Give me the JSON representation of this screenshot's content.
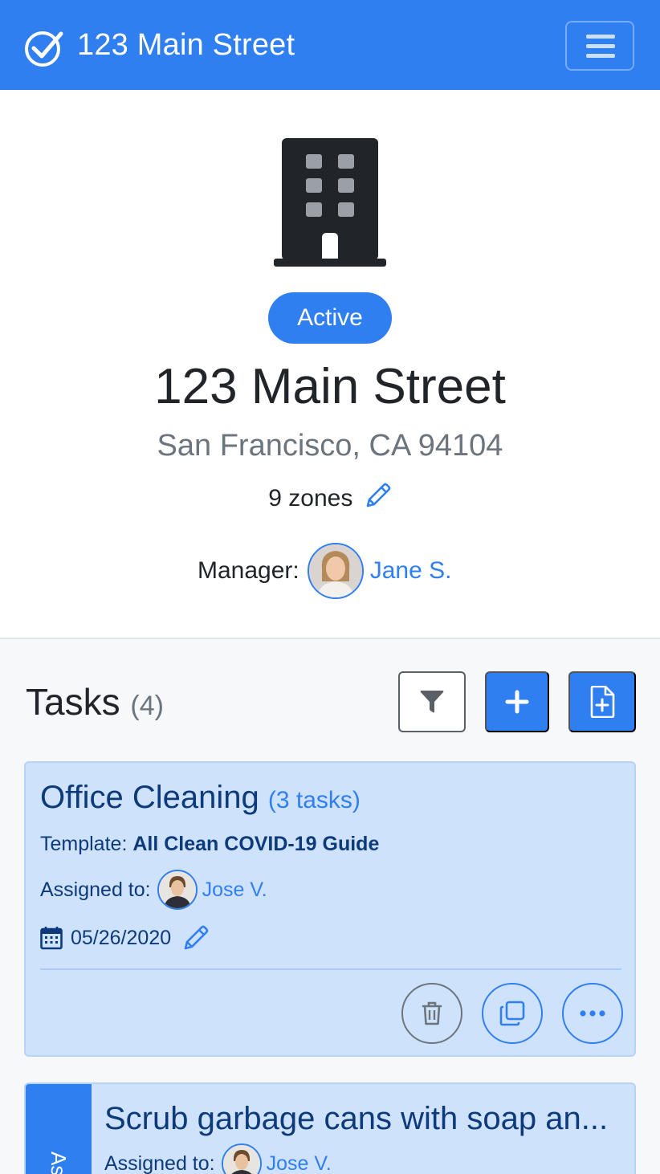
{
  "navbar": {
    "title": "123 Main Street",
    "brand_icon": "check-circle-icon",
    "menu_icon": "hamburger-menu-icon"
  },
  "property": {
    "icon": "building-icon",
    "status": "Active",
    "title": "123 Main Street",
    "address": "San Francisco, CA 94104",
    "zones": "9 zones",
    "manager_label": "Manager:",
    "manager_name": "Jane S."
  },
  "tasks": {
    "heading": "Tasks",
    "count": "(4)",
    "actions": [
      "filter-icon",
      "plus-icon",
      "file-plus-icon"
    ],
    "cards": [
      {
        "title": "Office Cleaning",
        "subtitle": "(3 tasks)",
        "template_label": "Template:",
        "template_name": "All Clean COVID-19 Guide",
        "assigned_label": "Assigned to:",
        "assignee": "Jose V.",
        "date": "05/26/2020",
        "buttons": [
          "trash-icon",
          "copy-icon",
          "more-icon"
        ]
      },
      {
        "stripe_text": "As",
        "title": "Scrub garbage cans with soap an...",
        "assigned_label": "Assigned to:",
        "assignee": "Jose V."
      }
    ]
  },
  "colors": {
    "primary": "#2f7ff1",
    "card_bg": "#cfe2fb",
    "card_text": "#0d3a7a",
    "muted": "#6c757d"
  }
}
